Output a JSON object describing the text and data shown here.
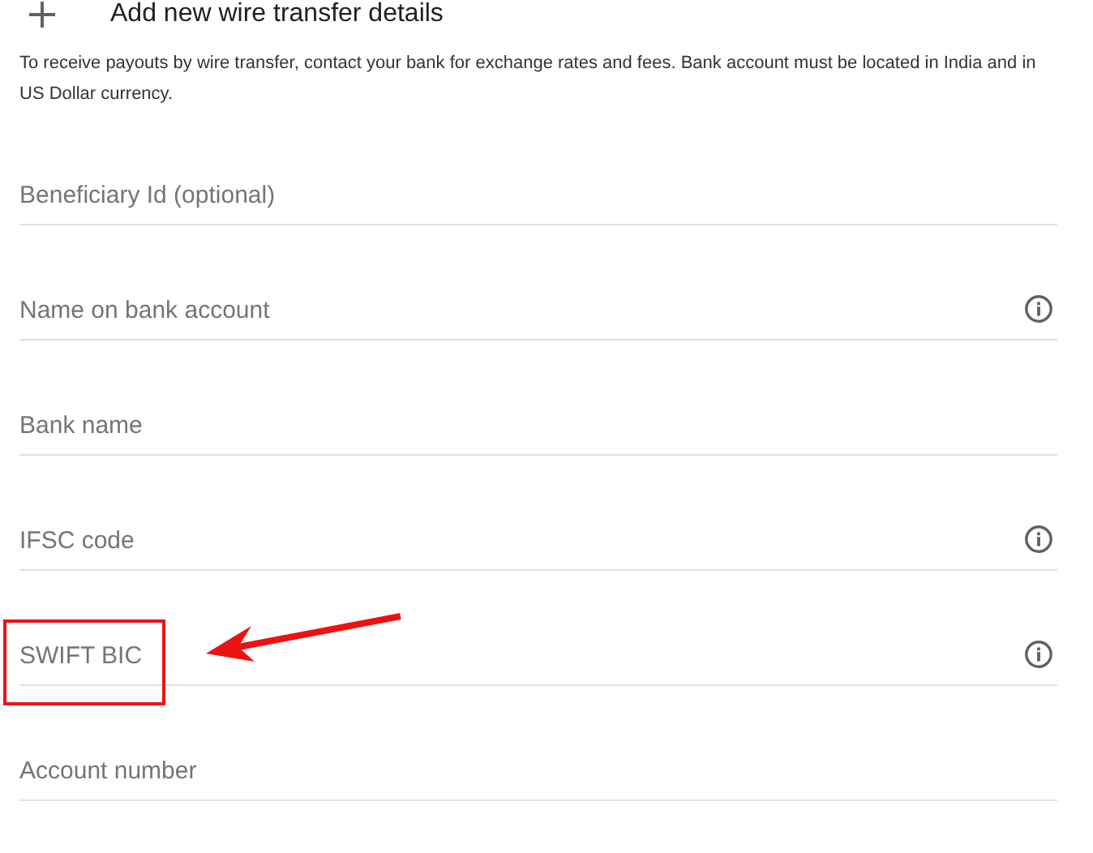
{
  "header": {
    "title": "Add new wire transfer details"
  },
  "description": "To receive payouts by wire transfer, contact your bank for exchange rates and fees. Bank account must be located in India and in US Dollar currency.",
  "fields": [
    {
      "placeholder": "Beneficiary Id (optional)",
      "info": false,
      "highlighted": false
    },
    {
      "placeholder": "Name on bank account",
      "info": true,
      "highlighted": false
    },
    {
      "placeholder": "Bank name",
      "info": false,
      "highlighted": false
    },
    {
      "placeholder": "IFSC code",
      "info": true,
      "highlighted": false
    },
    {
      "placeholder": "SWIFT BIC",
      "info": true,
      "highlighted": true
    },
    {
      "placeholder": "Account number",
      "info": false,
      "highlighted": false
    }
  ]
}
